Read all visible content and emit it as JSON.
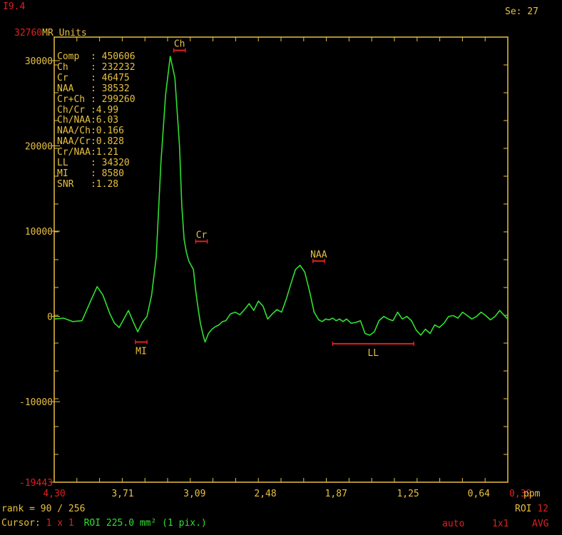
{
  "header": {
    "left_value": "I9.4",
    "series_label": "Se: 27"
  },
  "chart_data": {
    "type": "line",
    "title": "",
    "ylabel": "MR Units",
    "y_max_label": "32760",
    "xlabel": "ppm",
    "x_axis_reversed": true,
    "xlim": [
      4.3,
      0.39
    ],
    "ylim": [
      -19443,
      32760
    ],
    "x_tick_labels": [
      "4,30",
      "3,71",
      "3,09",
      "2,48",
      "1,87",
      "1,25",
      "0,64",
      "0,39"
    ],
    "x_tick_values": [
      4.3,
      3.71,
      3.09,
      2.48,
      1.87,
      1.25,
      0.64,
      0.39
    ],
    "y_tick_labels": [
      "30000",
      "20000",
      "10000",
      "0",
      "-10000",
      "-19443"
    ],
    "y_tick_values": [
      30000,
      20000,
      10000,
      0,
      -10000,
      -19443
    ],
    "series": [
      {
        "color": "#30e030",
        "x": [
          4.3,
          4.22,
          4.14,
          4.06,
          3.98,
          3.93,
          3.88,
          3.82,
          3.78,
          3.74,
          3.7,
          3.66,
          3.62,
          3.58,
          3.54,
          3.5,
          3.46,
          3.42,
          3.38,
          3.34,
          3.3,
          3.26,
          3.22,
          3.2,
          3.18,
          3.16,
          3.14,
          3.12,
          3.1,
          3.08,
          3.06,
          3.04,
          3.02,
          3.0,
          2.97,
          2.94,
          2.91,
          2.88,
          2.85,
          2.82,
          2.78,
          2.74,
          2.7,
          2.66,
          2.62,
          2.58,
          2.54,
          2.5,
          2.46,
          2.42,
          2.38,
          2.34,
          2.3,
          2.26,
          2.22,
          2.18,
          2.14,
          2.1,
          2.06,
          2.02,
          1.99,
          1.96,
          1.93,
          1.9,
          1.87,
          1.84,
          1.81,
          1.78,
          1.74,
          1.7,
          1.66,
          1.62,
          1.58,
          1.54,
          1.5,
          1.46,
          1.42,
          1.38,
          1.34,
          1.3,
          1.26,
          1.22,
          1.18,
          1.14,
          1.1,
          1.06,
          1.02,
          0.98,
          0.94,
          0.9,
          0.86,
          0.82,
          0.78,
          0.74,
          0.7,
          0.66,
          0.62,
          0.58,
          0.54,
          0.5,
          0.46,
          0.42,
          0.39
        ],
        "values": [
          -300,
          -200,
          -600,
          -500,
          2000,
          3500,
          2500,
          300,
          -800,
          -1300,
          -300,
          700,
          -600,
          -1800,
          -700,
          0,
          2500,
          7000,
          18000,
          26000,
          30500,
          28000,
          20000,
          13000,
          9000,
          7500,
          6500,
          6000,
          5500,
          3000,
          1000,
          -800,
          -2000,
          -3000,
          -2000,
          -1500,
          -1200,
          -1000,
          -600,
          -500,
          300,
          500,
          200,
          800,
          1500,
          700,
          1800,
          1200,
          -300,
          300,
          800,
          500,
          2000,
          3800,
          5500,
          6000,
          5200,
          3000,
          500,
          -400,
          -600,
          -300,
          -400,
          -200,
          -500,
          -300,
          -600,
          -300,
          -800,
          -700,
          -500,
          -2000,
          -2200,
          -1800,
          -500,
          0,
          -300,
          -500,
          500,
          -300,
          0,
          -500,
          -1600,
          -2200,
          -1500,
          -2000,
          -1000,
          -1300,
          -800,
          0,
          100,
          -200,
          500,
          100,
          -300,
          0,
          500,
          100,
          -400,
          0,
          700,
          100,
          -300
        ]
      }
    ],
    "peak_markers": [
      {
        "label": "Ch",
        "center": 3.22,
        "half_width": 0.05,
        "value": 31200,
        "label_side": "above"
      },
      {
        "label": "Cr",
        "center": 3.03,
        "half_width": 0.05,
        "value": 8800,
        "label_side": "above"
      },
      {
        "label": "NAA",
        "center": 2.02,
        "half_width": 0.05,
        "value": 6500,
        "label_side": "above"
      },
      {
        "label": "MI",
        "center": 3.55,
        "half_width": 0.05,
        "value": -3000,
        "label_side": "below"
      },
      {
        "label": "LL",
        "center": 1.55,
        "half_width": 0.35,
        "value": -3200,
        "label_side": "below"
      }
    ]
  },
  "metrics": [
    {
      "label": "Comp",
      "sep": "  : ",
      "value": "450606"
    },
    {
      "label": "Ch",
      "sep": "    : ",
      "value": "232232"
    },
    {
      "label": "Cr",
      "sep": "    : ",
      "value": "46475"
    },
    {
      "label": "NAA",
      "sep": "   : ",
      "value": "38532"
    },
    {
      "label": "Cr+Ch",
      "sep": " : ",
      "value": "299260"
    },
    {
      "label": "Ch/Cr",
      "sep": " :",
      "value": "4.99"
    },
    {
      "label": "Ch/NAA",
      "sep": ":",
      "value": "6.03"
    },
    {
      "label": "NAA/Ch",
      "sep": ":",
      "value": "0.166"
    },
    {
      "label": "NAA/Cr",
      "sep": ":",
      "value": "0.828"
    },
    {
      "label": "Cr/NAA",
      "sep": ":",
      "value": "1.21"
    },
    {
      "label": "LL",
      "sep": "    : ",
      "value": "34320"
    },
    {
      "label": "MI",
      "sep": "    : ",
      "value": "8580"
    },
    {
      "label": "SNR",
      "sep": "   :",
      "value": "1.28"
    }
  ],
  "footer": {
    "rank_text": "rank = 90 / 256",
    "roi_label": "ROI",
    "roi_number": "12",
    "cursor_label": "Cursor:",
    "cursor_value": "1 x 1",
    "roi_info": "ROI 225.0 mm² (1 pix.)",
    "mode_auto": "auto",
    "mode_grid": "1x1",
    "mode_avg": "AVG"
  },
  "colors": {
    "axis": "#e8c040",
    "trace": "#30e030",
    "marker": "#e02020",
    "red_text": "#e02020"
  }
}
